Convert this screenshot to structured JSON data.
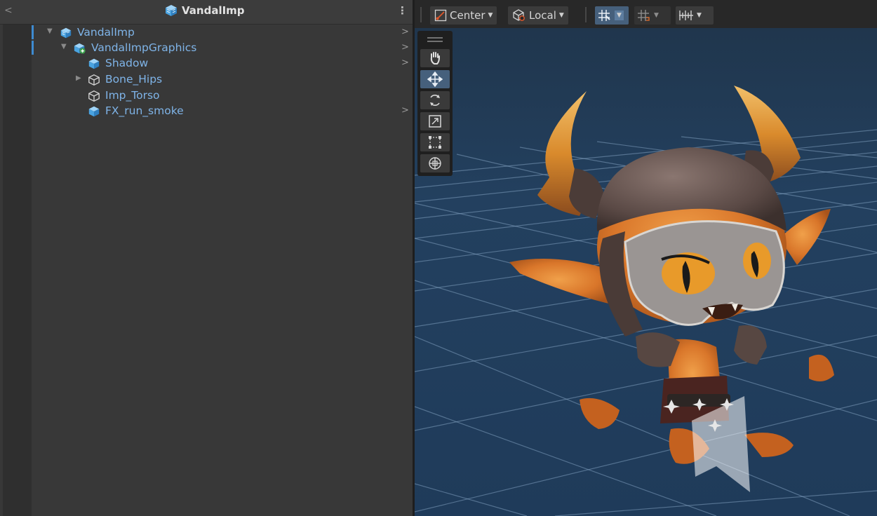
{
  "hierarchy": {
    "title": "VandalImp",
    "menu_glyph": "⋮",
    "back_glyph": "<",
    "rows": [
      {
        "label": "VandalImp",
        "icon": "prefab-root-icon",
        "expanded": true
      },
      {
        "label": "VandalImpGraphics",
        "icon": "prefab-added-icon",
        "expanded": true
      },
      {
        "label": "Shadow",
        "icon": "prefab-icon"
      },
      {
        "label": "Bone_Hips",
        "icon": "gameobject-icon",
        "collapsed": true
      },
      {
        "label": "Imp_Torso",
        "icon": "gameobject-icon"
      },
      {
        "label": "FX_run_smoke",
        "icon": "prefab-icon"
      }
    ]
  },
  "scene_toolbar": {
    "pivot_label": "Center",
    "space_label": "Local",
    "snap_icon": "grid-snap-icon",
    "increment_icon": "increment-snap-icon",
    "ruler_icon": "ruler-icon"
  },
  "tools": [
    "hand-tool",
    "move-tool",
    "rotate-tool",
    "scale-tool",
    "rect-tool",
    "transform-tool"
  ],
  "colors": {
    "selection": "#3e8bd1",
    "label_blue": "#7fb4e8",
    "sky": "#1f3a57",
    "grid": "#8fb0cc",
    "active_button": "#46607c"
  }
}
